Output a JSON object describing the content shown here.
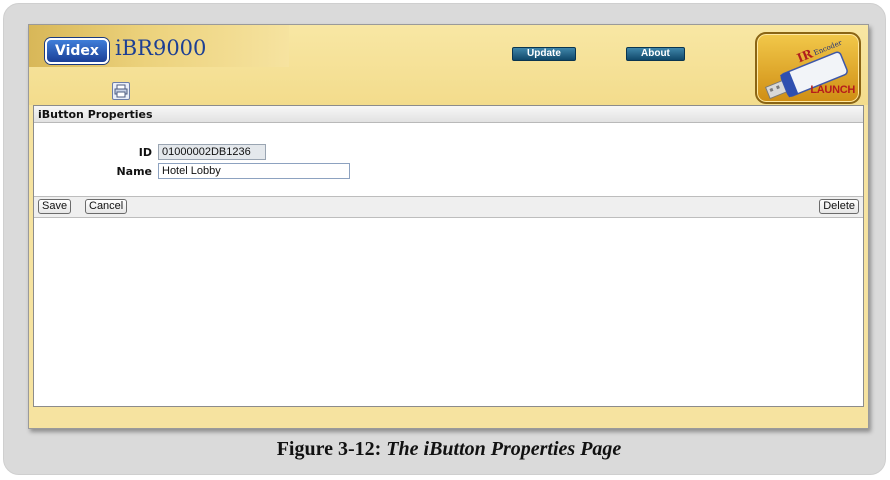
{
  "app": {
    "brand_badge": "Videx",
    "product_name": "iBR9000",
    "print_icon": "printer-icon"
  },
  "header": {
    "update_label": "Update",
    "about_label": "About",
    "launch": {
      "brand": "IR",
      "brand_sub": "Encoder",
      "label": "LAUNCH",
      "icon": "usb-drive-icon"
    }
  },
  "panel": {
    "title": "iButton Properties",
    "fields": [
      {
        "label": "ID",
        "value": "01000002DB1236",
        "readonly": true
      },
      {
        "label": "Name",
        "value": "Hotel Lobby",
        "readonly": false
      }
    ]
  },
  "actions": {
    "save_label": "Save",
    "cancel_label": "Cancel",
    "delete_label": "Delete"
  },
  "caption": {
    "prefix": "Figure 3-12:",
    "title": "The iButton Properties Page"
  },
  "colors": {
    "app_background": "#f6e3a0",
    "header_button": "#1c5478",
    "brand_blue": "#1c3f94",
    "launch_gold": "#e0a830",
    "readonly_field": "#e4e8ec"
  }
}
